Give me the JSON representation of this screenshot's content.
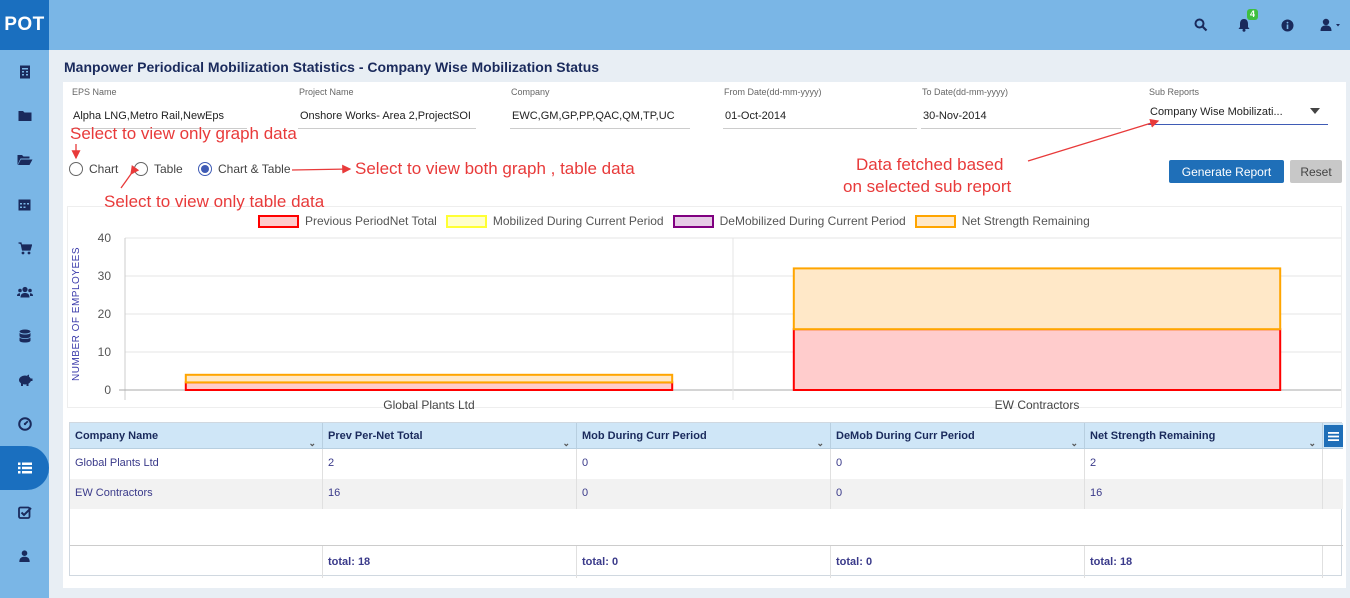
{
  "app": {
    "logo": "POT",
    "notification_count": "4"
  },
  "header_icons": [
    "search-icon",
    "bell-icon",
    "info-icon",
    "user-icon"
  ],
  "sidebar": {
    "items": [
      "report-icon",
      "folder-icon",
      "folder-open-icon",
      "calendar-icon",
      "cart-icon",
      "users-icon",
      "database-icon",
      "piggy-bank-icon",
      "dashboard-icon",
      "list-icon",
      "check-icon",
      "user-icon"
    ],
    "active_index": 9
  },
  "page": {
    "title": "Manpower Periodical Mobilization Statistics - Company Wise Mobilization Status"
  },
  "filters": {
    "eps": {
      "label": "EPS Name",
      "value": "Alpha LNG,Metro Rail,NewEps"
    },
    "project": {
      "label": "Project Name",
      "value": "Onshore  Works- Area 2,ProjectSOI"
    },
    "company": {
      "label": "Company",
      "value": "EWC,GM,GP,PP,QAC,QM,TP,UC"
    },
    "from_date": {
      "label": "From Date(dd-mm-yyyy)",
      "value": "01-Oct-2014"
    },
    "to_date": {
      "label": "To Date(dd-mm-yyyy)",
      "value": "30-Nov-2014"
    },
    "sub_reports": {
      "label": "Sub Reports",
      "value": "Company Wise Mobilizati..."
    }
  },
  "view_options": {
    "chart": "Chart",
    "table": "Table",
    "chart_table": "Chart & Table",
    "selected": "chart_table"
  },
  "buttons": {
    "generate": "Generate Report",
    "reset": "Reset"
  },
  "annotations": {
    "graph_only": "Select to view only graph data",
    "table_only": "Select to view only table data",
    "both": "Select to view both graph , table data",
    "fetched_line1": "Data fetched based",
    "fetched_line2": "on selected sub report"
  },
  "colors": {
    "prev": "#ff0000",
    "prev_fill": "#ffcccc",
    "mob": "#ffff33",
    "mob_fill": "#ffffcc",
    "demob": "#800080",
    "demob_fill": "#e6cce6",
    "net": "#ffa500",
    "net_fill": "#ffe8c8"
  },
  "chart_data": {
    "type": "bar",
    "stacked": true,
    "categories": [
      "Global  Plants Ltd",
      "EW Contractors"
    ],
    "series": [
      {
        "name": "Previous PeriodNet Total",
        "values": [
          2,
          16
        ]
      },
      {
        "name": "Mobilized During Current Period",
        "values": [
          0,
          0
        ]
      },
      {
        "name": "DeMobilized During Current Period",
        "values": [
          0,
          0
        ]
      },
      {
        "name": "Net Strength Remaining",
        "values": [
          2,
          16
        ]
      }
    ],
    "ylabel": "NUMBER OF EMPLOYEES",
    "ylim": [
      0,
      40
    ],
    "yticks": [
      "0",
      "10",
      "20",
      "30",
      "40"
    ],
    "grid": true,
    "legend": "top"
  },
  "table": {
    "columns": [
      "Company Name",
      "Prev Per-Net Total",
      "Mob During Curr Period",
      "DeMob During Curr Period",
      "Net Strength Remaining"
    ],
    "rows": [
      [
        "Global Plants Ltd",
        "2",
        "0",
        "0",
        "2"
      ],
      [
        "EW Contractors",
        "16",
        "0",
        "0",
        "16"
      ]
    ],
    "totals": [
      "",
      "total: 18",
      "total: 0",
      "total: 0",
      "total: 18"
    ]
  }
}
